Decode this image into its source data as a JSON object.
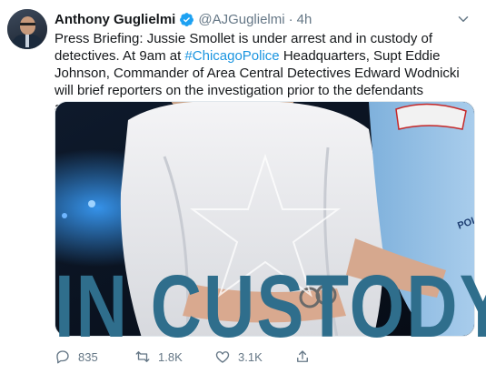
{
  "tweet": {
    "author_name": "Anthony Guglielmi",
    "handle": "@AJGuglielmi",
    "separator": "·",
    "time": "4h",
    "text_before": "Press Briefing: Jussie Smollet is under arrest and in custody of detectives. At 9am at ",
    "hashtag": "#ChicagoPolice",
    "text_after": " Headquarters, Supt Eddie Johnson, Commander of Area Central Detectives Edward Wodnicki will brief reporters on the investigation prior to the defendants appearance in court."
  },
  "media": {
    "overlay_text": "IN CUSTODY",
    "patch_text": "POLICE"
  },
  "actions": {
    "replies": "835",
    "retweets": "1.8K",
    "likes": "3.1K"
  },
  "colors": {
    "link": "#1b95e0",
    "secondary": "#657786",
    "verified": "#1da1f2",
    "overlay": "#2f6e8c"
  },
  "icons": [
    "verified-badge-icon",
    "chevron-down-icon",
    "reply-icon",
    "retweet-icon",
    "like-icon",
    "share-icon"
  ]
}
